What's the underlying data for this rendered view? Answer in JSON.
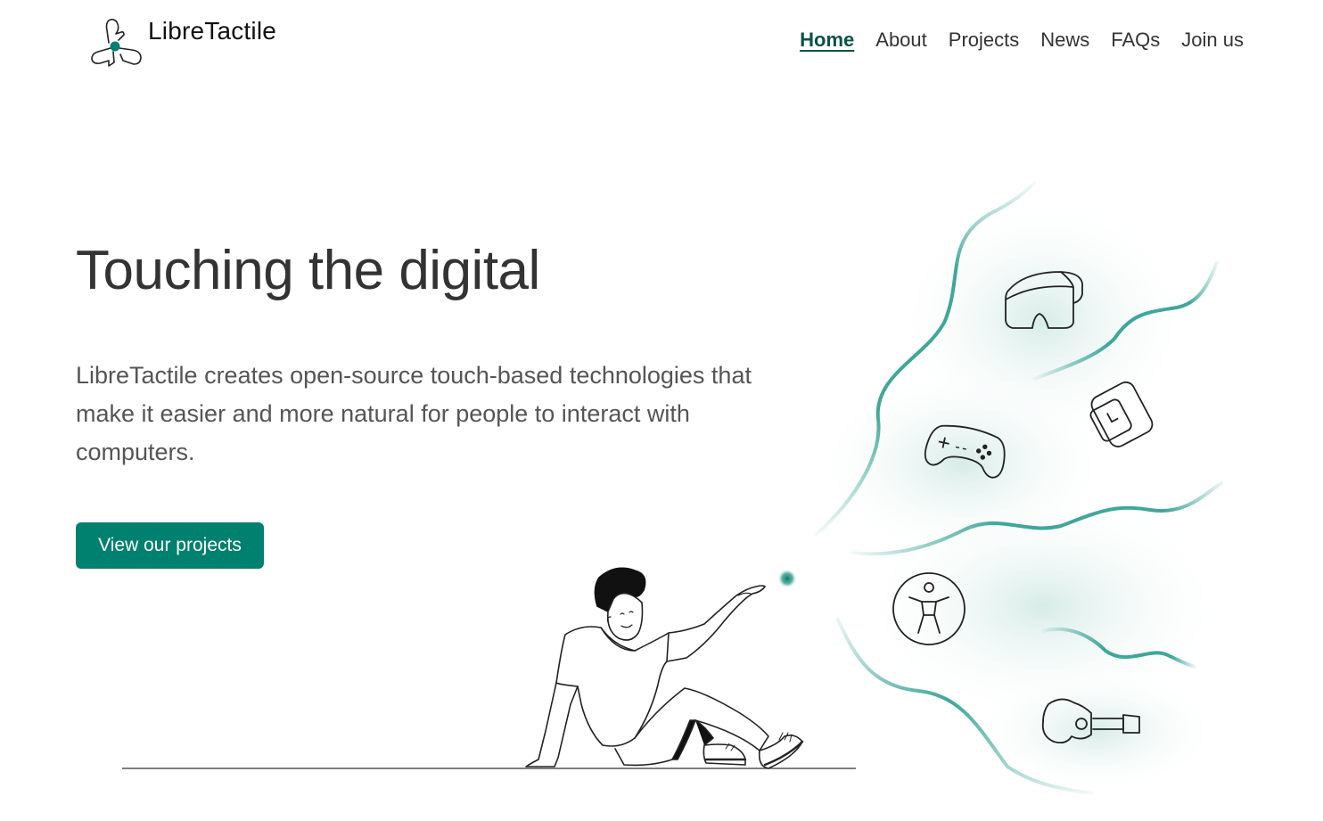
{
  "brand": {
    "name": "LibreTactile"
  },
  "nav": {
    "items": [
      {
        "label": "Home",
        "active": true
      },
      {
        "label": "About",
        "active": false
      },
      {
        "label": "Projects",
        "active": false
      },
      {
        "label": "News",
        "active": false
      },
      {
        "label": "FAQs",
        "active": false
      },
      {
        "label": "Join us",
        "active": false
      }
    ]
  },
  "hero": {
    "title": "Touching the digital",
    "description": "LibreTactile creates open-source touch-based technologies that make it easier and more natural for people to interact with computers.",
    "cta_label": "View our projects"
  },
  "illustration": {
    "icons": [
      "vr-headset-icon",
      "smartwatch-icon",
      "gamepad-icon",
      "accessibility-icon",
      "guitar-icon"
    ]
  },
  "colors": {
    "accent": "#00806f",
    "accent_dark": "#0b5247",
    "wave": "#2a9d8f",
    "text": "#333333"
  }
}
